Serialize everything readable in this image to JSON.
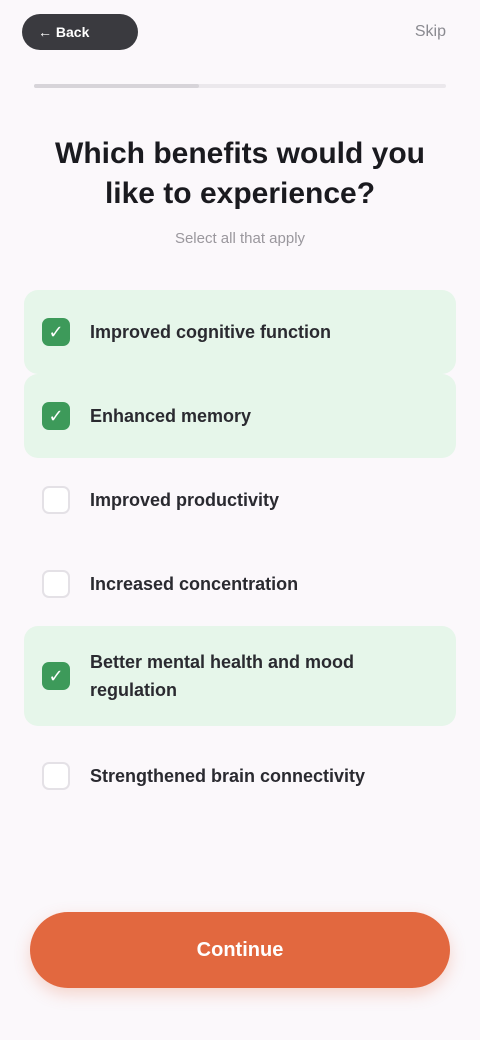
{
  "header": {
    "back_label": "← Back",
    "skip_label": "Skip"
  },
  "progress": {
    "fraction": 0.4
  },
  "title": "Which benefits would you like to experience?",
  "subtitle": "Select all that apply",
  "options": [
    {
      "label": "Improved cognitive function",
      "selected": true
    },
    {
      "label": "Enhanced memory",
      "selected": true
    },
    {
      "label": "Improved productivity",
      "selected": false
    },
    {
      "label": "Increased concentration",
      "selected": false
    },
    {
      "label": "Better mental health and mood regulation",
      "selected": true
    },
    {
      "label": "Strengthened brain connectivity",
      "selected": false
    }
  ],
  "continue_label": "Continue",
  "colors": {
    "accent": "#e2683f",
    "selected_bg": "#e6f6ea",
    "check_green": "#3d9a5a"
  },
  "icons": {
    "checkmark": "check-icon"
  }
}
